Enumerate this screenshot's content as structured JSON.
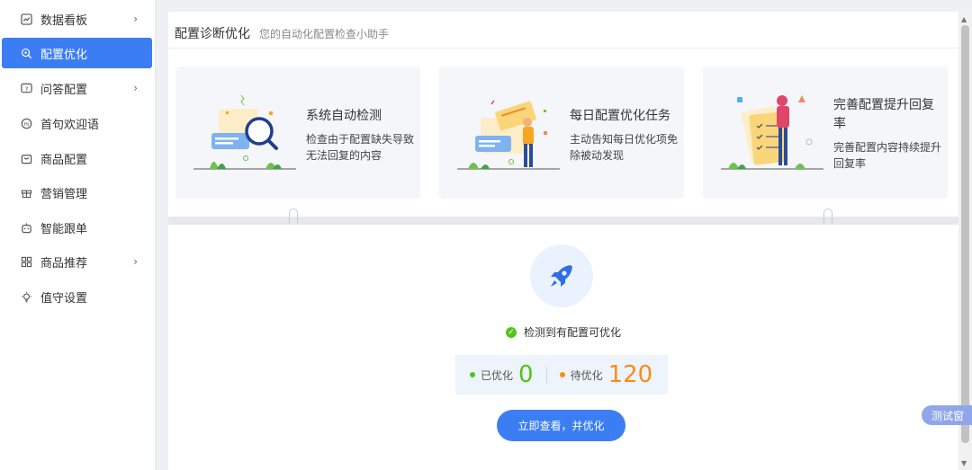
{
  "sidebar": {
    "items": [
      {
        "label": "数据看板",
        "icon": "chart-icon",
        "chevron": "›"
      },
      {
        "label": "配置优化",
        "icon": "search-settings-icon",
        "active": true
      },
      {
        "label": "问答配置",
        "icon": "question-icon",
        "chevron": "›"
      },
      {
        "label": "首句欢迎语",
        "icon": "welcome-icon"
      },
      {
        "label": "商品配置",
        "icon": "bag-icon"
      },
      {
        "label": "营销管理",
        "icon": "gift-icon"
      },
      {
        "label": "智能跟单",
        "icon": "robot-icon"
      },
      {
        "label": "商品推荐",
        "icon": "grid-icon",
        "chevron": "›"
      },
      {
        "label": "值守设置",
        "icon": "bulb-icon"
      }
    ]
  },
  "header": {
    "title": "配置诊断优化",
    "subtitle": "您的自动化配置检查小助手"
  },
  "cards": [
    {
      "title": "系统自动检测",
      "desc": "检查由于配置缺失导致无法回复的内容",
      "icon": "magnifier-illustration"
    },
    {
      "title": "每日配置优化任务",
      "desc": "主动告知每日优化项免除被动发现",
      "icon": "task-illustration"
    },
    {
      "title": "完善配置提升回复率",
      "desc": "完善配置内容持续提升回复率",
      "icon": "checklist-illustration"
    }
  ],
  "status": {
    "text": "检测到有配置可优化",
    "optimized_label": "已优化",
    "optimized_count": "0",
    "pending_label": "待优化",
    "pending_count": "120"
  },
  "action_button": "立即查看，并优化",
  "float_button": "测试窗",
  "colors": {
    "primary": "#3b7ef4",
    "success": "#52c41a",
    "warning": "#fa8c16"
  }
}
